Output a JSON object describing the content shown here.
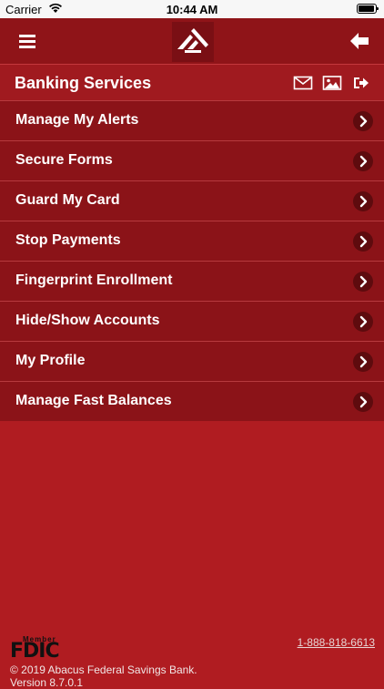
{
  "status_bar": {
    "carrier": "Carrier",
    "time": "10:44 AM",
    "icons": [
      "wifi-icon",
      "battery-icon"
    ]
  },
  "nav_bar": {
    "menu_icon": "hamburger-icon",
    "logo_icon": "bank-logo-icon",
    "back_icon": "back-arrow-icon"
  },
  "section": {
    "title": "Banking Services",
    "icons": [
      "mail-icon",
      "image-icon",
      "logout-icon"
    ]
  },
  "menu_items": [
    {
      "label": "Manage My Alerts"
    },
    {
      "label": "Secure Forms"
    },
    {
      "label": "Guard My Card"
    },
    {
      "label": "Stop Payments"
    },
    {
      "label": "Fingerprint Enrollment"
    },
    {
      "label": "Hide/Show Accounts"
    },
    {
      "label": "My Profile"
    },
    {
      "label": "Manage Fast Balances"
    }
  ],
  "footer": {
    "fdic_member": "Member",
    "fdic_word": "FDIC",
    "phone": "1-888-818-6613",
    "copyright": "© 2019 Abacus Federal Savings Bank.",
    "version": "Version 8.7.0.1"
  },
  "colors": {
    "background": "#b01c21",
    "nav_bar": "#8f1418",
    "menu_item": "#8b1318",
    "chevron_bg": "#5e0b0e"
  }
}
